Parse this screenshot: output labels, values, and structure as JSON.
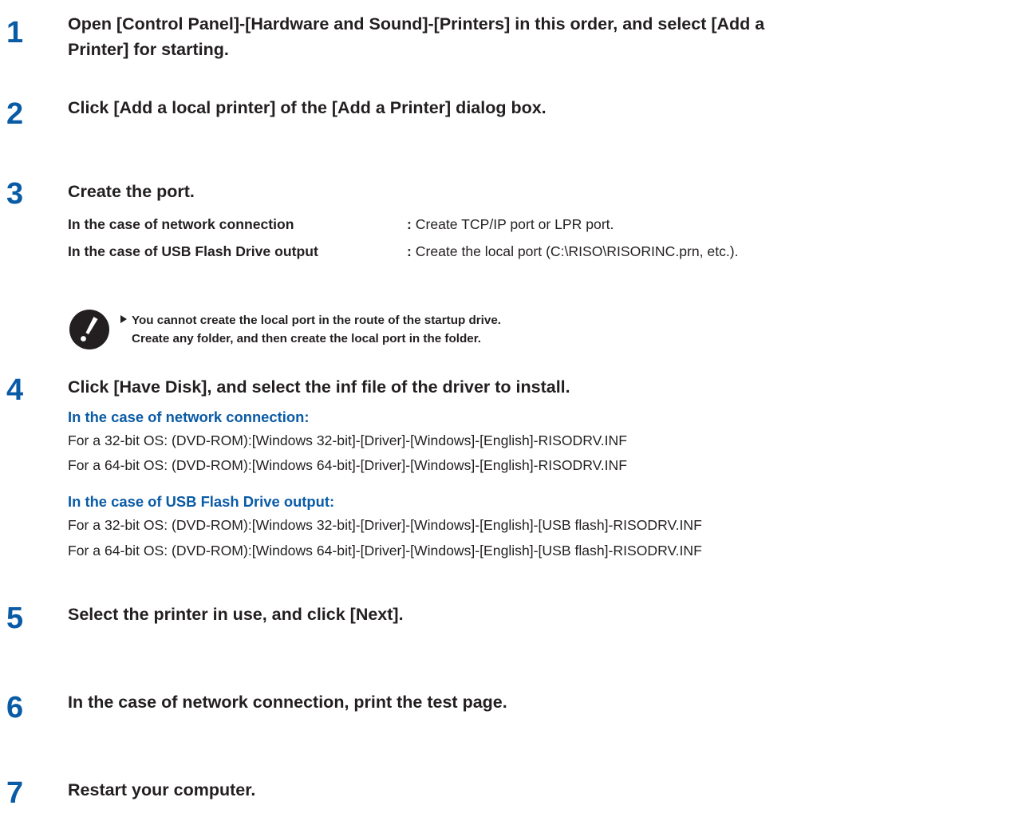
{
  "steps": [
    {
      "number": "1",
      "title_line1": "Open [Control Panel]-[Hardware and Sound]-[Printers] in this order, and select [Add a",
      "title_line2": "Printer] for starting."
    },
    {
      "number": "2",
      "title": "Click [Add a local printer] of the [Add a Printer] dialog box."
    },
    {
      "number": "3",
      "title": "Create the port.",
      "rows": [
        {
          "label": "In the case of network connection",
          "text": "Create TCP/IP port or LPR port."
        },
        {
          "label": "In the case of USB Flash Drive output",
          "text": "Create the local port (C:\\RISO\\RISORINC.prn, etc.)."
        }
      ],
      "note": {
        "icon": "exclamation-icon",
        "line1": "You cannot create the local port in the route of the startup drive.",
        "line2": "Create any folder, and then create the local port in the folder."
      }
    },
    {
      "number": "4",
      "title": "Click [Have Disk], and select the inf file of the driver to install.",
      "sections": [
        {
          "heading": "In the case of network connection:",
          "paths": [
            "For a 32-bit OS: (DVD-ROM):[Windows 32-bit]-[Driver]-[Windows]-[English]-RISODRV.INF",
            "For a 64-bit OS: (DVD-ROM):[Windows 64-bit]-[Driver]-[Windows]-[English]-RISODRV.INF"
          ]
        },
        {
          "heading": "In the case of USB Flash Drive output:",
          "paths": [
            "For a 32-bit OS: (DVD-ROM):[Windows 32-bit]-[Driver]-[Windows]-[English]-[USB flash]-RISODRV.INF",
            "For a 64-bit OS: (DVD-ROM):[Windows 64-bit]-[Driver]-[Windows]-[English]-[USB flash]-RISODRV.INF"
          ]
        }
      ]
    },
    {
      "number": "5",
      "title": "Select the printer in use, and click [Next]."
    },
    {
      "number": "6",
      "title": "In the case of network connection, print the test page."
    },
    {
      "number": "7",
      "title": "Restart your computer."
    }
  ],
  "colors": {
    "accent": "#0a5ba6",
    "text": "#231f20"
  }
}
